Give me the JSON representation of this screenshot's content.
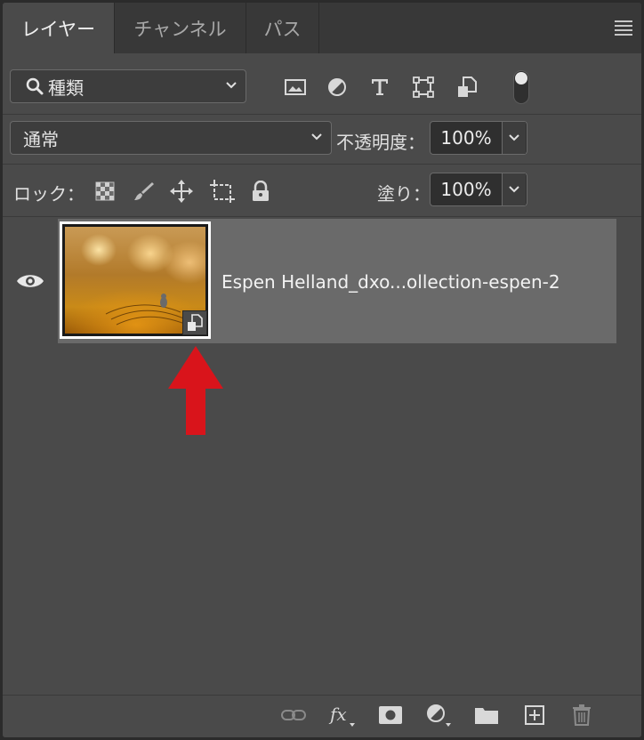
{
  "tabs": [
    {
      "label": "レイヤー",
      "active": true
    },
    {
      "label": "チャンネル",
      "active": false
    },
    {
      "label": "パス",
      "active": false
    }
  ],
  "filter": {
    "selected": "種類",
    "icons": [
      "image-filter-icon",
      "adjustment-filter-icon",
      "type-filter-icon",
      "shape-filter-icon",
      "smart-object-filter-icon"
    ],
    "toggle_on": true
  },
  "blend": {
    "mode": "通常",
    "opacity_label": "不透明度：",
    "opacity_value": "100%"
  },
  "lock": {
    "label": "ロック：",
    "fill_label": "塗り：",
    "fill_value": "100%"
  },
  "layer": {
    "name": "Espen Helland_dxo...ollection-espen-2",
    "visible": true,
    "type": "smart-object"
  },
  "annotation": {
    "arrow_color": "#d9141b"
  },
  "colors": {
    "panel_bg": "#4a4a4a",
    "tabbar_bg": "#383838",
    "selected_row": "#6a6a6a"
  }
}
